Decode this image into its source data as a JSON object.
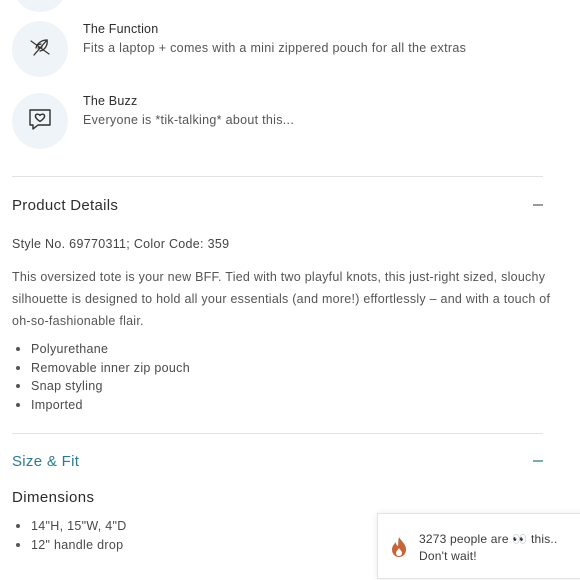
{
  "features": [
    {
      "icon": "feather-icon",
      "title": "The Function",
      "description": "Fits a laptop + comes with a mini zippered pouch for all the extras"
    },
    {
      "icon": "chat-heart-icon",
      "title": "The Buzz",
      "description": "Everyone is *tik-talking* about this..."
    }
  ],
  "product_details": {
    "heading": "Product Details",
    "collapse_symbol": "−",
    "style_line": "Style No. 69770311; Color Code: 359",
    "description": "This oversized tote is your new BFF. Tied with two playful knots, this just-right sized, slouchy silhouette is designed to hold all your essentials (and more!) effortlessly – and with a touch of oh-so-fashionable flair.",
    "bullets": [
      "Polyurethane",
      "Removable inner zip pouch",
      "Snap styling",
      "Imported"
    ]
  },
  "size_fit": {
    "heading": "Size & Fit",
    "dimensions_heading": "Dimensions",
    "bullets": [
      "14\"H, 15\"W, 4\"D",
      "12\" handle drop"
    ]
  },
  "toast": {
    "icon": "flame-icon",
    "message_line1": "3273 people are 👀 this..",
    "message_line2": "Don't wait!"
  },
  "colors": {
    "icon_bg": "#eef4f7",
    "accent": "#2b7c93",
    "flame": "#c8643a"
  }
}
